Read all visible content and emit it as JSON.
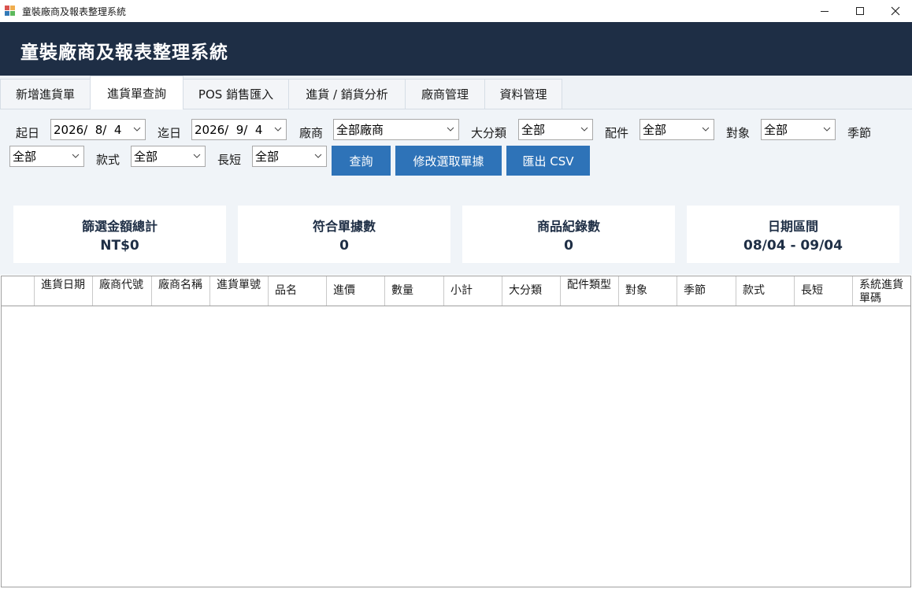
{
  "window": {
    "title": "童裝廠商及報表整理系統",
    "minimize_icon": "minimize-icon",
    "maximize_icon": "maximize-icon",
    "close_icon": "close-icon"
  },
  "banner": {
    "title": "童裝廠商及報表整理系統"
  },
  "tabs": [
    {
      "label": "新增進貨單",
      "active": false
    },
    {
      "label": "進貨單查詢",
      "active": true
    },
    {
      "label": "POS 銷售匯入",
      "active": false
    },
    {
      "label": "進貨 / 銷貨分析",
      "active": false
    },
    {
      "label": "廠商管理",
      "active": false
    },
    {
      "label": "資料管理",
      "active": false
    }
  ],
  "filters": {
    "start_label": "起日",
    "start_value": "2026/  8/  4",
    "end_label": "迄日",
    "end_value": "2026/  9/  4",
    "vendor_label": "廠商",
    "vendor_value": "全部廠商",
    "category_label": "大分類",
    "category_value": "全部",
    "accessory_label": "配件",
    "accessory_value": "全部",
    "target_label": "對象",
    "target_value": "全部",
    "season_label": "季節",
    "season_value": "全部",
    "style_label": "款式",
    "style_value": "全部",
    "length_label": "長短",
    "length_value": "全部",
    "query_button": "查詢",
    "edit_button": "修改選取單據",
    "export_button": "匯出 CSV"
  },
  "summary": [
    {
      "label": "篩選金額總計",
      "value": "NT$0"
    },
    {
      "label": "符合單據數",
      "value": "0"
    },
    {
      "label": "商品紀錄數",
      "value": "0"
    },
    {
      "label": "日期區間",
      "value": "08/04 - 09/04"
    }
  ],
  "grid": {
    "columns": [
      "進貨日期",
      "廠商代號",
      "廠商名稱",
      "進貨單號",
      "品名",
      "進價",
      "數量",
      "小計",
      "大分類",
      "配件類型",
      "對象",
      "季節",
      "款式",
      "長短",
      "系統進貨單碼"
    ],
    "rows": []
  },
  "colors": {
    "banner": "#1e2e45",
    "button": "#2e73b8",
    "filter_bg": "#f0f4f8"
  }
}
